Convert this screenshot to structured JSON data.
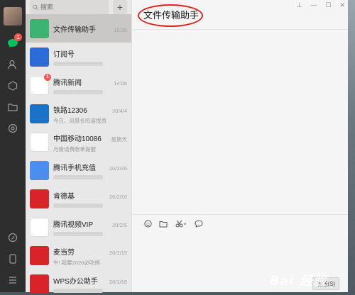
{
  "search": {
    "placeholder": "搜索"
  },
  "add_label": "+",
  "rail": {
    "chat_badge": "1"
  },
  "conversations": [
    {
      "name": "文件传输助手",
      "time": "15:35",
      "preview": "",
      "color": "#3cb371",
      "icon": "folder-icon"
    },
    {
      "name": "订阅号",
      "time": "",
      "preview": "",
      "color": "#2b6cd8",
      "icon": "subscription-icon"
    },
    {
      "name": "腾讯新闻",
      "time": "14:08",
      "preview": "",
      "color": "#ffffff",
      "badge": "1",
      "icon": "tencent-news-icon"
    },
    {
      "name": "铁路12306",
      "time": "20/4/4",
      "preview": "今日、风景长鸣喜悦思",
      "color": "#1a73c9",
      "icon": "railway-icon"
    },
    {
      "name": "中国移动10086",
      "time": "星期天",
      "preview": "月度话费账单提醒",
      "color": "#ffffff",
      "icon": "china-mobile-icon"
    },
    {
      "name": "腾讯手机充值",
      "time": "20/2/26",
      "preview": "",
      "color": "#4a8ff0",
      "icon": "phone-topup-icon"
    },
    {
      "name": "肯德基",
      "time": "20/2/10",
      "preview": "",
      "color": "#d8232a",
      "icon": "kfc-icon"
    },
    {
      "name": "腾讯视频VIP",
      "time": "20/2/5",
      "preview": "",
      "color": "#ffffff",
      "icon": "tencent-video-icon"
    },
    {
      "name": "麦当劳",
      "time": "20/1/15",
      "preview": "牛! 我要2020必吃榜",
      "color": "#d8232a",
      "icon": "mcdonalds-icon"
    },
    {
      "name": "WPS办公助手",
      "time": "20/1/18",
      "preview": "",
      "color": "#d8232a",
      "icon": "wps-icon"
    }
  ],
  "chat": {
    "title": "文件传输助手",
    "send_label": "发送(S)"
  },
  "watermark": "Bai 经验",
  "colors": {
    "accent": "#07c160",
    "highlight_circle": "#d9261c",
    "badge": "#fa5151"
  }
}
